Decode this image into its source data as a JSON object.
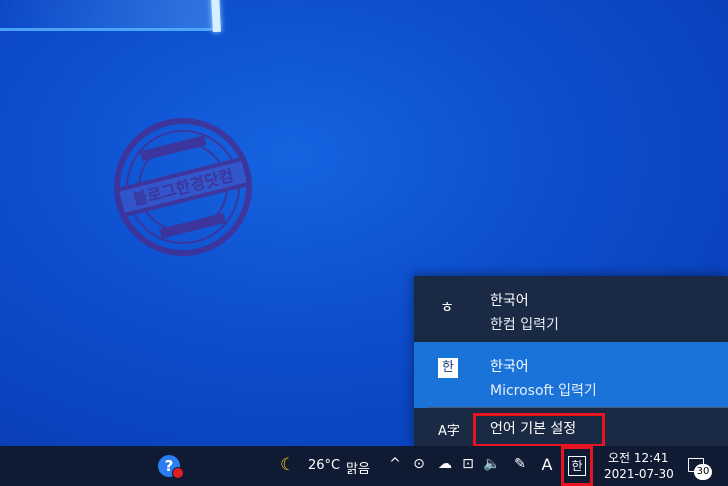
{
  "desktop": {
    "stamp_text": "블로그한경닷컴"
  },
  "ime_popup": {
    "items": [
      {
        "icon": "ㅎ",
        "language": "한국어",
        "method": "한컴 입력기",
        "selected": false
      },
      {
        "icon": "한",
        "language": "한국어",
        "method": "Microsoft 입력기",
        "selected": true
      }
    ],
    "language_preferences_label": "언어 기본 설정"
  },
  "taskbar": {
    "weather_icon": "moon-icon",
    "temperature": "26°C",
    "condition": "맑음",
    "tray_icons": [
      "^",
      "⊙",
      "☁",
      "⊡",
      "🔈",
      "✎",
      "A"
    ],
    "ime_indicator": "한",
    "time": "오전 12:41",
    "date": "2021-07-30",
    "notification_count": "30"
  },
  "colors": {
    "highlight": "#e8141f",
    "selected_item": "#1a73d9",
    "taskbar": "#0f1a33"
  }
}
